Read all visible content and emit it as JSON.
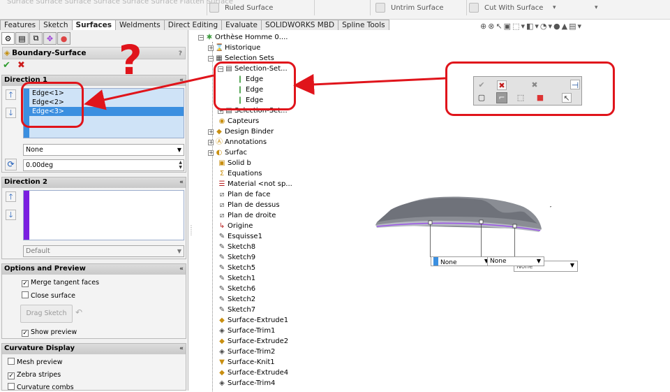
{
  "ribbon": {
    "faded_text": "Surface   Surface   Surface   Surface   Surface   Surface               Flatten                                                     Surface",
    "ruled_surface": "Ruled Surface",
    "untrim_surface": "Untrim Surface",
    "cut_with_surface": "Cut With Surface"
  },
  "tabs": [
    "Features",
    "Sketch",
    "Surfaces",
    "Weldments",
    "Direct Editing",
    "Evaluate",
    "SOLIDWORKS MBD",
    "Spline Tools"
  ],
  "active_tab": "Surfaces",
  "property_manager": {
    "title": "Boundary-Surface",
    "help": "?",
    "direction1": {
      "heading": "Direction 1",
      "items": [
        "Edge<1>",
        "Edge<2>",
        "Edge<3>"
      ],
      "selected_index": 2,
      "tangency": "None",
      "angle": "0.00deg",
      "color": "#3b8fe0"
    },
    "direction2": {
      "heading": "Direction 2",
      "tangency": "Default",
      "color": "#7a1fe0"
    },
    "options": {
      "heading": "Options and Preview",
      "merge_tangent_faces": "Merge tangent faces",
      "close_surface": "Close surface",
      "drag_sketch": "Drag Sketch",
      "show_preview": "Show preview"
    },
    "curvature": {
      "heading": "Curvature Display",
      "mesh_preview": "Mesh preview",
      "zebra_stripes": "Zebra stripes",
      "curvature_combs": "Curvature combs"
    }
  },
  "annotation": {
    "question_mark": "?",
    "color": "#e0141b"
  },
  "tree": {
    "root": "Orthèse Homme 0....",
    "historique": "Historique",
    "selection_sets": "Selection Sets",
    "selection_set_1": "Selection-Set...",
    "edges": [
      "Edge",
      "Edge",
      "Edge"
    ],
    "selection_set_2": "Selection-Set...",
    "capteurs": "Capteurs",
    "design_binder": "Design Binder",
    "annotations": "Annotations",
    "surfac": "Surfac",
    "solid": "Solid b",
    "equations": "Equations",
    "material": "Material <not sp...",
    "plan_face": "Plan de face",
    "plan_dessus": "Plan de dessus",
    "plan_droite": "Plan de droite",
    "origine": "Origine",
    "sketches": [
      "Esquisse1",
      "Sketch8",
      "Sketch9",
      "Sketch5",
      "Sketch1",
      "Sketch6",
      "Sketch2",
      "Sketch7"
    ],
    "features": [
      "Surface-Extrude1",
      "Surface-Trim1",
      "Surface-Extrude2",
      "Surface-Trim2",
      "Surface-Knit1",
      "Surface-Extrude4",
      "Surface-Trim4"
    ]
  },
  "graphics": {
    "combo1": "None",
    "combo2": "None",
    "combo3": "None"
  }
}
